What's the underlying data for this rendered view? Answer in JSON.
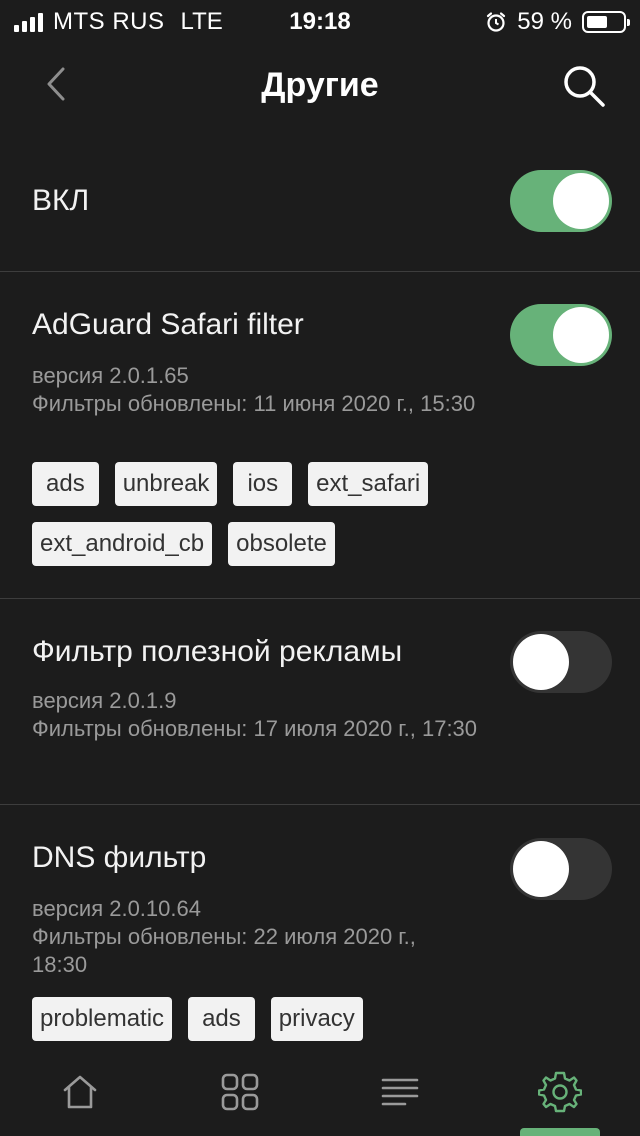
{
  "status_bar": {
    "carrier": "MTS RUS",
    "network": "LTE",
    "time": "19:18",
    "battery": "59 %",
    "battery_level": 0.59
  },
  "nav": {
    "title": "Другие",
    "back_icon": "chevron-left-icon",
    "search_icon": "search-icon"
  },
  "master_toggle": {
    "label": "ВКЛ",
    "on": true
  },
  "filters": [
    {
      "title": "AdGuard Safari filter",
      "version": "версия 2.0.1.65",
      "updated": "Фильтры обновлены: 11 июня 2020 г., 15:30",
      "on": true,
      "tags": [
        "ads",
        "unbreak",
        "ios",
        "ext_safari",
        "ext_android_cb",
        "obsolete"
      ]
    },
    {
      "title": "Фильтр полезной рекламы",
      "version": "версия 2.0.1.9",
      "updated": "Фильтры обновлены: 17 июля 2020 г., 17:30",
      "on": false,
      "tags": []
    },
    {
      "title": "DNS фильтр",
      "version": "версия 2.0.10.64",
      "updated": "Фильтры обновлены: 22 июля 2020 г., 18:30",
      "on": false,
      "tags": [
        "problematic",
        "ads",
        "privacy"
      ]
    }
  ],
  "tab_bar": {
    "tabs": [
      "home-icon",
      "grid-icon",
      "list-icon",
      "gear-icon"
    ],
    "active": "gear-icon",
    "accent": "#67b279"
  },
  "colors": {
    "background": "#1c1c1c",
    "toggle_on": "#67b279",
    "toggle_off": "#343434"
  }
}
